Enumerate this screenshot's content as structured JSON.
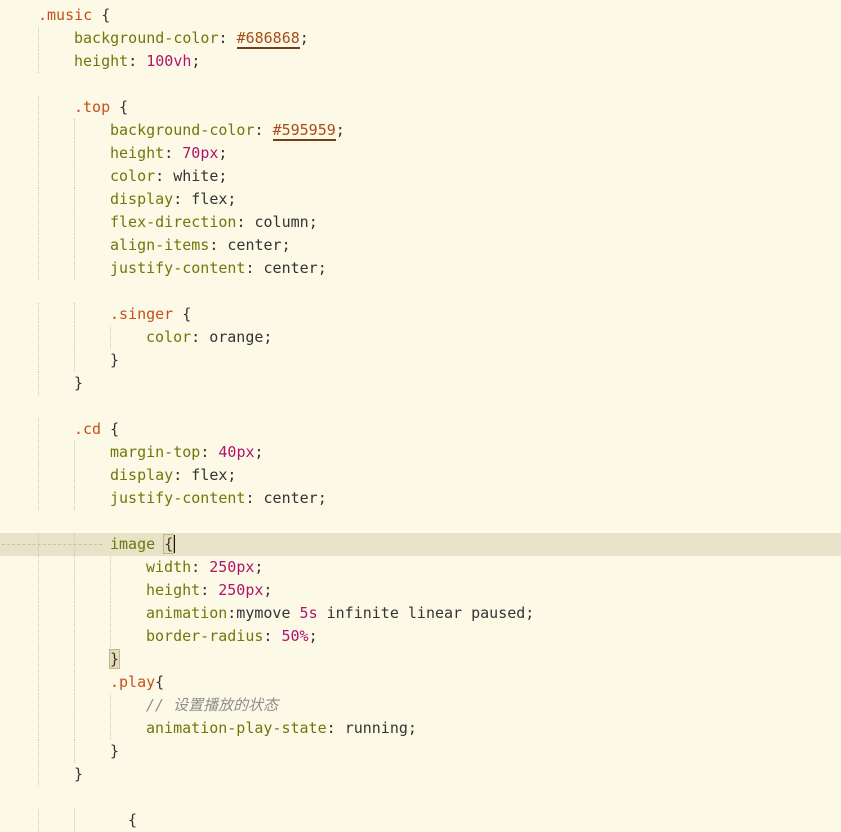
{
  "editor": {
    "language": "css",
    "theme": {
      "background": "#fdf9e7",
      "current_line": "#e8e2c8"
    },
    "lines": [
      {
        "indent": 1,
        "parts": [
          {
            "t": ".music",
            "c": "sel"
          },
          {
            "t": " {",
            "c": "brace"
          }
        ]
      },
      {
        "indent": 2,
        "parts": [
          {
            "t": "background-color",
            "c": "prop"
          },
          {
            "t": ": ",
            "c": "punct"
          },
          {
            "t": "#686868",
            "c": "hex"
          },
          {
            "t": ";",
            "c": "punct"
          }
        ]
      },
      {
        "indent": 2,
        "parts": [
          {
            "t": "height",
            "c": "prop"
          },
          {
            "t": ": ",
            "c": "punct"
          },
          {
            "t": "100",
            "c": "num"
          },
          {
            "t": "vh",
            "c": "unit"
          },
          {
            "t": ";",
            "c": "punct"
          }
        ]
      },
      {
        "indent": 0,
        "parts": []
      },
      {
        "indent": 2,
        "parts": [
          {
            "t": ".top",
            "c": "sel"
          },
          {
            "t": " {",
            "c": "brace"
          }
        ]
      },
      {
        "indent": 3,
        "parts": [
          {
            "t": "background-color",
            "c": "prop"
          },
          {
            "t": ": ",
            "c": "punct"
          },
          {
            "t": "#595959",
            "c": "hex"
          },
          {
            "t": ";",
            "c": "punct"
          }
        ]
      },
      {
        "indent": 3,
        "parts": [
          {
            "t": "height",
            "c": "prop"
          },
          {
            "t": ": ",
            "c": "punct"
          },
          {
            "t": "70",
            "c": "num"
          },
          {
            "t": "px",
            "c": "unit"
          },
          {
            "t": ";",
            "c": "punct"
          }
        ]
      },
      {
        "indent": 3,
        "parts": [
          {
            "t": "color",
            "c": "prop"
          },
          {
            "t": ": ",
            "c": "punct"
          },
          {
            "t": "white",
            "c": "val"
          },
          {
            "t": ";",
            "c": "punct"
          }
        ]
      },
      {
        "indent": 3,
        "parts": [
          {
            "t": "display",
            "c": "prop"
          },
          {
            "t": ": ",
            "c": "punct"
          },
          {
            "t": "flex",
            "c": "val"
          },
          {
            "t": ";",
            "c": "punct"
          }
        ]
      },
      {
        "indent": 3,
        "parts": [
          {
            "t": "flex-direction",
            "c": "prop"
          },
          {
            "t": ": ",
            "c": "punct"
          },
          {
            "t": "column",
            "c": "val"
          },
          {
            "t": ";",
            "c": "punct"
          }
        ]
      },
      {
        "indent": 3,
        "parts": [
          {
            "t": "align-items",
            "c": "prop"
          },
          {
            "t": ": ",
            "c": "punct"
          },
          {
            "t": "center",
            "c": "val"
          },
          {
            "t": ";",
            "c": "punct"
          }
        ]
      },
      {
        "indent": 3,
        "parts": [
          {
            "t": "justify-content",
            "c": "prop"
          },
          {
            "t": ": ",
            "c": "punct"
          },
          {
            "t": "center",
            "c": "val"
          },
          {
            "t": ";",
            "c": "punct"
          }
        ]
      },
      {
        "indent": 0,
        "parts": []
      },
      {
        "indent": 3,
        "parts": [
          {
            "t": ".singer",
            "c": "sel"
          },
          {
            "t": " {",
            "c": "brace"
          }
        ]
      },
      {
        "indent": 4,
        "parts": [
          {
            "t": "color",
            "c": "prop"
          },
          {
            "t": ": ",
            "c": "punct"
          },
          {
            "t": "orange",
            "c": "val"
          },
          {
            "t": ";",
            "c": "punct"
          }
        ]
      },
      {
        "indent": 3,
        "parts": [
          {
            "t": "}",
            "c": "brace"
          }
        ]
      },
      {
        "indent": 2,
        "parts": [
          {
            "t": "}",
            "c": "brace"
          }
        ]
      },
      {
        "indent": 0,
        "parts": []
      },
      {
        "indent": 2,
        "parts": [
          {
            "t": ".cd",
            "c": "sel"
          },
          {
            "t": " {",
            "c": "brace"
          }
        ]
      },
      {
        "indent": 3,
        "parts": [
          {
            "t": "margin-top",
            "c": "prop"
          },
          {
            "t": ": ",
            "c": "punct"
          },
          {
            "t": "40",
            "c": "num"
          },
          {
            "t": "px",
            "c": "unit"
          },
          {
            "t": ";",
            "c": "punct"
          }
        ]
      },
      {
        "indent": 3,
        "parts": [
          {
            "t": "display",
            "c": "prop"
          },
          {
            "t": ": ",
            "c": "punct"
          },
          {
            "t": "flex",
            "c": "val"
          },
          {
            "t": ";",
            "c": "punct"
          }
        ]
      },
      {
        "indent": 3,
        "parts": [
          {
            "t": "justify-content",
            "c": "prop"
          },
          {
            "t": ": ",
            "c": "punct"
          },
          {
            "t": "center",
            "c": "val"
          },
          {
            "t": ";",
            "c": "punct"
          }
        ]
      },
      {
        "indent": 0,
        "parts": []
      },
      {
        "indent": 3,
        "current": true,
        "parts": [
          {
            "t": "image",
            "c": "prop"
          },
          {
            "t": " ",
            "c": "punct"
          },
          {
            "t": "{",
            "c": "match-brace"
          },
          {
            "cursor": true
          }
        ]
      },
      {
        "indent": 4,
        "parts": [
          {
            "t": "width",
            "c": "prop"
          },
          {
            "t": ": ",
            "c": "punct"
          },
          {
            "t": "250",
            "c": "num"
          },
          {
            "t": "px",
            "c": "unit"
          },
          {
            "t": ";",
            "c": "punct"
          }
        ]
      },
      {
        "indent": 4,
        "parts": [
          {
            "t": "height",
            "c": "prop"
          },
          {
            "t": ": ",
            "c": "punct"
          },
          {
            "t": "250",
            "c": "num"
          },
          {
            "t": "px",
            "c": "unit"
          },
          {
            "t": ";",
            "c": "punct"
          }
        ]
      },
      {
        "indent": 4,
        "parts": [
          {
            "t": "animation",
            "c": "prop"
          },
          {
            "t": ":mymove ",
            "c": "punct"
          },
          {
            "t": "5",
            "c": "num"
          },
          {
            "t": "s",
            "c": "unit"
          },
          {
            "t": " infinite linear paused;",
            "c": "val"
          }
        ]
      },
      {
        "indent": 4,
        "parts": [
          {
            "t": "border-radius",
            "c": "prop"
          },
          {
            "t": ": ",
            "c": "punct"
          },
          {
            "t": "50",
            "c": "num"
          },
          {
            "t": "%",
            "c": "unit"
          },
          {
            "t": ";",
            "c": "punct"
          }
        ]
      },
      {
        "indent": 3,
        "parts": [
          {
            "t": "}",
            "c": "match-brace"
          }
        ]
      },
      {
        "indent": 3,
        "parts": [
          {
            "t": ".play",
            "c": "sel"
          },
          {
            "t": "{",
            "c": "brace"
          }
        ]
      },
      {
        "indent": 4,
        "parts": [
          {
            "t": "// 设置播放的状态",
            "c": "comment"
          }
        ]
      },
      {
        "indent": 4,
        "parts": [
          {
            "t": "animation-play-state",
            "c": "prop"
          },
          {
            "t": ": ",
            "c": "punct"
          },
          {
            "t": "running",
            "c": "val"
          },
          {
            "t": ";",
            "c": "punct"
          }
        ]
      },
      {
        "indent": 3,
        "parts": [
          {
            "t": "}",
            "c": "brace"
          }
        ]
      },
      {
        "indent": 2,
        "parts": [
          {
            "t": "}",
            "c": "brace"
          }
        ]
      },
      {
        "indent": 0,
        "parts": []
      },
      {
        "indent": 3,
        "parts": [
          {
            "t": "  {",
            "c": "brace"
          }
        ]
      }
    ]
  }
}
